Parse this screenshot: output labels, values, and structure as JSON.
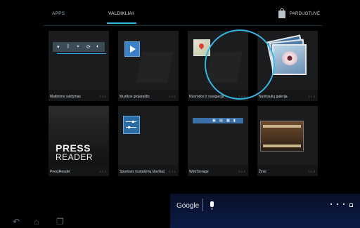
{
  "header": {
    "tabs": [
      {
        "label": "APPS",
        "active": false
      },
      {
        "label": "VALDIKLIAI",
        "active": true
      }
    ],
    "store_label": "PARDUOTUVĖ"
  },
  "widgets": [
    {
      "label": "Maitinimo valdymas",
      "size": "4 x 1"
    },
    {
      "label": "Muzikos grojaraštis",
      "size": "2 x 1"
    },
    {
      "label": "Nuorodos ir navigacija",
      "size": "1 x 1"
    },
    {
      "label": "Nuotraukų galerija",
      "size": "2 x 2"
    },
    {
      "label": "PressReader",
      "size": "3 x 4"
    },
    {
      "label": "Spartusis nustatymų klavišas",
      "size": "1 x 1"
    },
    {
      "label": "WebStorage",
      "size": "3 x 1"
    },
    {
      "label": "Žinio",
      "size": "3 x 3"
    }
  ],
  "press_words": [
    "PRESS",
    "READER"
  ],
  "search": {
    "brand": "Google"
  },
  "nav": {
    "back_icon": "back-icon",
    "home_icon": "home-icon",
    "recents_icon": "recents-icon"
  },
  "colors": {
    "accent": "#33b5e5",
    "background": "#000000"
  }
}
